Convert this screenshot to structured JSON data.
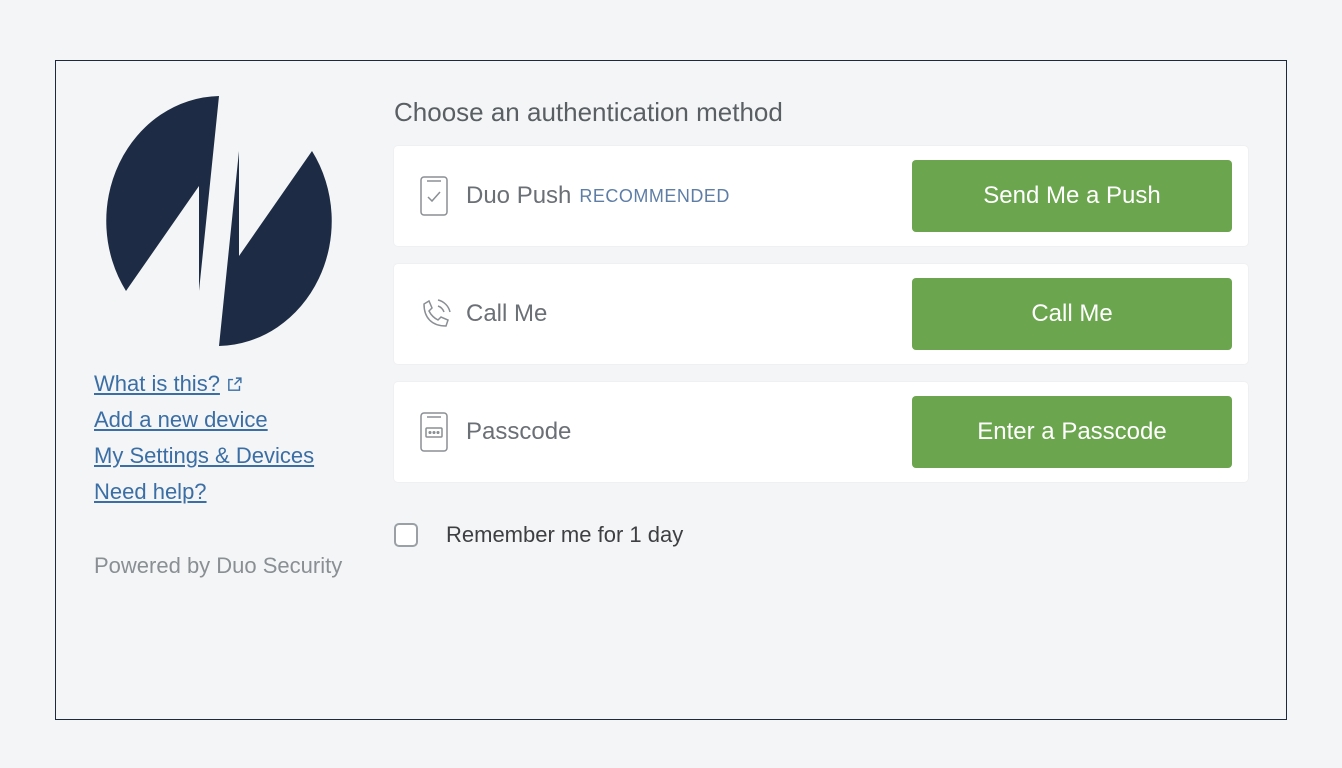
{
  "sidebar": {
    "links": {
      "what_is_this": "What is this?",
      "add_device": "Add a new device",
      "settings": "My Settings & Devices",
      "need_help": "Need help?"
    },
    "powered": "Powered by Duo Security"
  },
  "main": {
    "heading": "Choose an authentication method",
    "methods": {
      "push": {
        "label": "Duo Push",
        "badge": "RECOMMENDED",
        "button": "Send Me a Push"
      },
      "call": {
        "label": "Call Me",
        "button": "Call Me"
      },
      "passcode": {
        "label": "Passcode",
        "button": "Enter a Passcode"
      }
    },
    "remember": "Remember me for 1 day"
  },
  "colors": {
    "accent_green": "#6ba64e",
    "logo_navy": "#1d2c44",
    "link_blue": "#3a6ea5"
  }
}
